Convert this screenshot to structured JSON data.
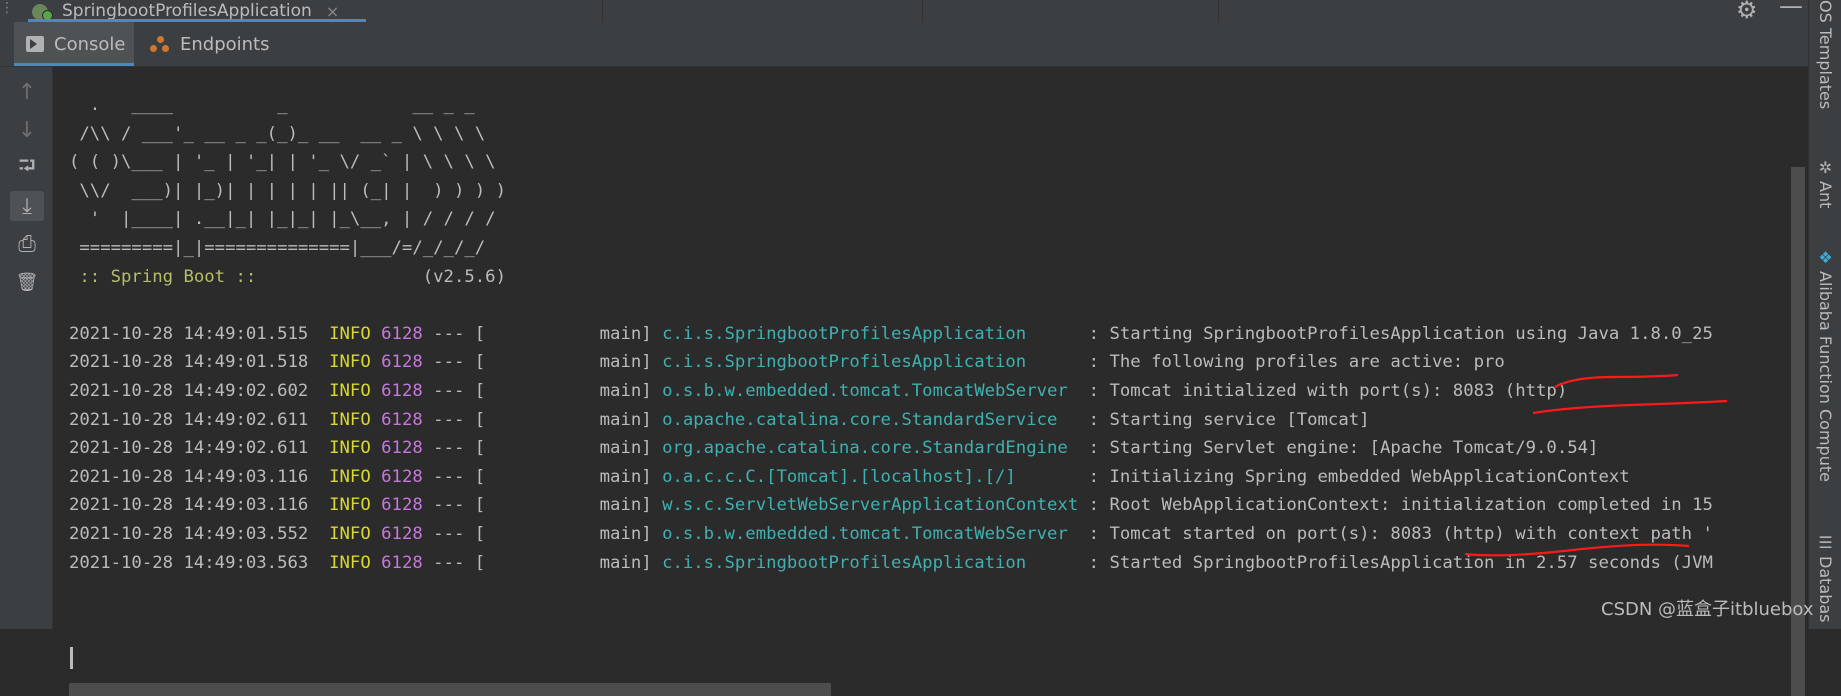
{
  "run_tab": {
    "label": "SpringbootProfilesApplication",
    "close": "×"
  },
  "toolbar": {
    "console_label": "Console",
    "endpoints_label": "Endpoints"
  },
  "gutter": {
    "buttons": [
      {
        "icon": "up-arrow-icon",
        "glyph": "↑"
      },
      {
        "icon": "down-arrow-icon",
        "glyph": "↓"
      },
      {
        "icon": "soft-wrap-icon",
        "glyph": "⮒"
      },
      {
        "icon": "scroll-to-end-icon",
        "glyph": "⤓"
      },
      {
        "icon": "print-icon",
        "glyph": "⎙"
      },
      {
        "icon": "trash-icon",
        "glyph": "🗑"
      }
    ]
  },
  "banner": {
    "lines": [
      "  .   ____          _            __ _ _",
      " /\\\\ / ___'_ __ _ _(_)_ __  __ _ \\ \\ \\ \\",
      "( ( )\\___ | '_ | '_| | '_ \\/ _` | \\ \\ \\ \\",
      " \\\\/  ___)| |_)| | | | | || (_| |  ) ) ) )",
      "  '  |____| .__|_| |_|_| |_\\__, | / / / /",
      " =========|_|==============|___/=/_/_/_/"
    ],
    "spring_label": " :: Spring Boot :: ",
    "version": "               (v2.5.6)"
  },
  "logs": [
    {
      "ts": "2021-10-28 14:49:01.515",
      "level": "INFO",
      "pid": "6128",
      "thread": " --- [           main] ",
      "logger": "c.i.s.SpringbootProfilesApplication      ",
      "message": ": Starting SpringbootProfilesApplication using Java 1.8.0_25"
    },
    {
      "ts": "2021-10-28 14:49:01.518",
      "level": "INFO",
      "pid": "6128",
      "thread": " --- [           main] ",
      "logger": "c.i.s.SpringbootProfilesApplication      ",
      "message": ": The following profiles are active: pro"
    },
    {
      "ts": "2021-10-28 14:49:02.602",
      "level": "INFO",
      "pid": "6128",
      "thread": " --- [           main] ",
      "logger": "o.s.b.w.embedded.tomcat.TomcatWebServer  ",
      "message": ": Tomcat initialized with port(s): 8083 (http)"
    },
    {
      "ts": "2021-10-28 14:49:02.611",
      "level": "INFO",
      "pid": "6128",
      "thread": " --- [           main] ",
      "logger": "o.apache.catalina.core.StandardService   ",
      "message": ": Starting service [Tomcat]"
    },
    {
      "ts": "2021-10-28 14:49:02.611",
      "level": "INFO",
      "pid": "6128",
      "thread": " --- [           main] ",
      "logger": "org.apache.catalina.core.StandardEngine  ",
      "message": ": Starting Servlet engine: [Apache Tomcat/9.0.54]"
    },
    {
      "ts": "2021-10-28 14:49:03.116",
      "level": "INFO",
      "pid": "6128",
      "thread": " --- [           main] ",
      "logger": "o.a.c.c.C.[Tomcat].[localhost].[/]       ",
      "message": ": Initializing Spring embedded WebApplicationContext"
    },
    {
      "ts": "2021-10-28 14:49:03.116",
      "level": "INFO",
      "pid": "6128",
      "thread": " --- [           main] ",
      "logger": "w.s.c.ServletWebServerApplicationContext ",
      "message": ": Root WebApplicationContext: initialization completed in 15"
    },
    {
      "ts": "2021-10-28 14:49:03.552",
      "level": "INFO",
      "pid": "6128",
      "thread": " --- [           main] ",
      "logger": "o.s.b.w.embedded.tomcat.TomcatWebServer  ",
      "message": ": Tomcat started on port(s): 8083 (http) with context path '"
    },
    {
      "ts": "2021-10-28 14:49:03.563",
      "level": "INFO",
      "pid": "6128",
      "thread": " --- [           main] ",
      "logger": "c.i.s.SpringbootProfilesApplication      ",
      "message": ": Started SpringbootProfilesApplication in 2.57 seconds (JVM"
    }
  ],
  "side_panel": {
    "items": [
      {
        "label": "OS Templates",
        "icon": ""
      },
      {
        "label": "Ant",
        "icon": "ant-icon"
      },
      {
        "label": "Alibaba Function Compute",
        "icon": "function-compute-icon"
      },
      {
        "label": "Databas",
        "icon": "database-icon"
      }
    ]
  },
  "watermark": "CSDN @蓝盒子itbluebox",
  "colors": {
    "background": "#2b2b2b",
    "panel": "#3c3f41",
    "accent": "#4a88c7",
    "info": "#d8d82e",
    "pid": "#c678dd",
    "logger": "#3fb0b0",
    "spring": "#b5bd68",
    "annotation": "#ff1a1a"
  }
}
